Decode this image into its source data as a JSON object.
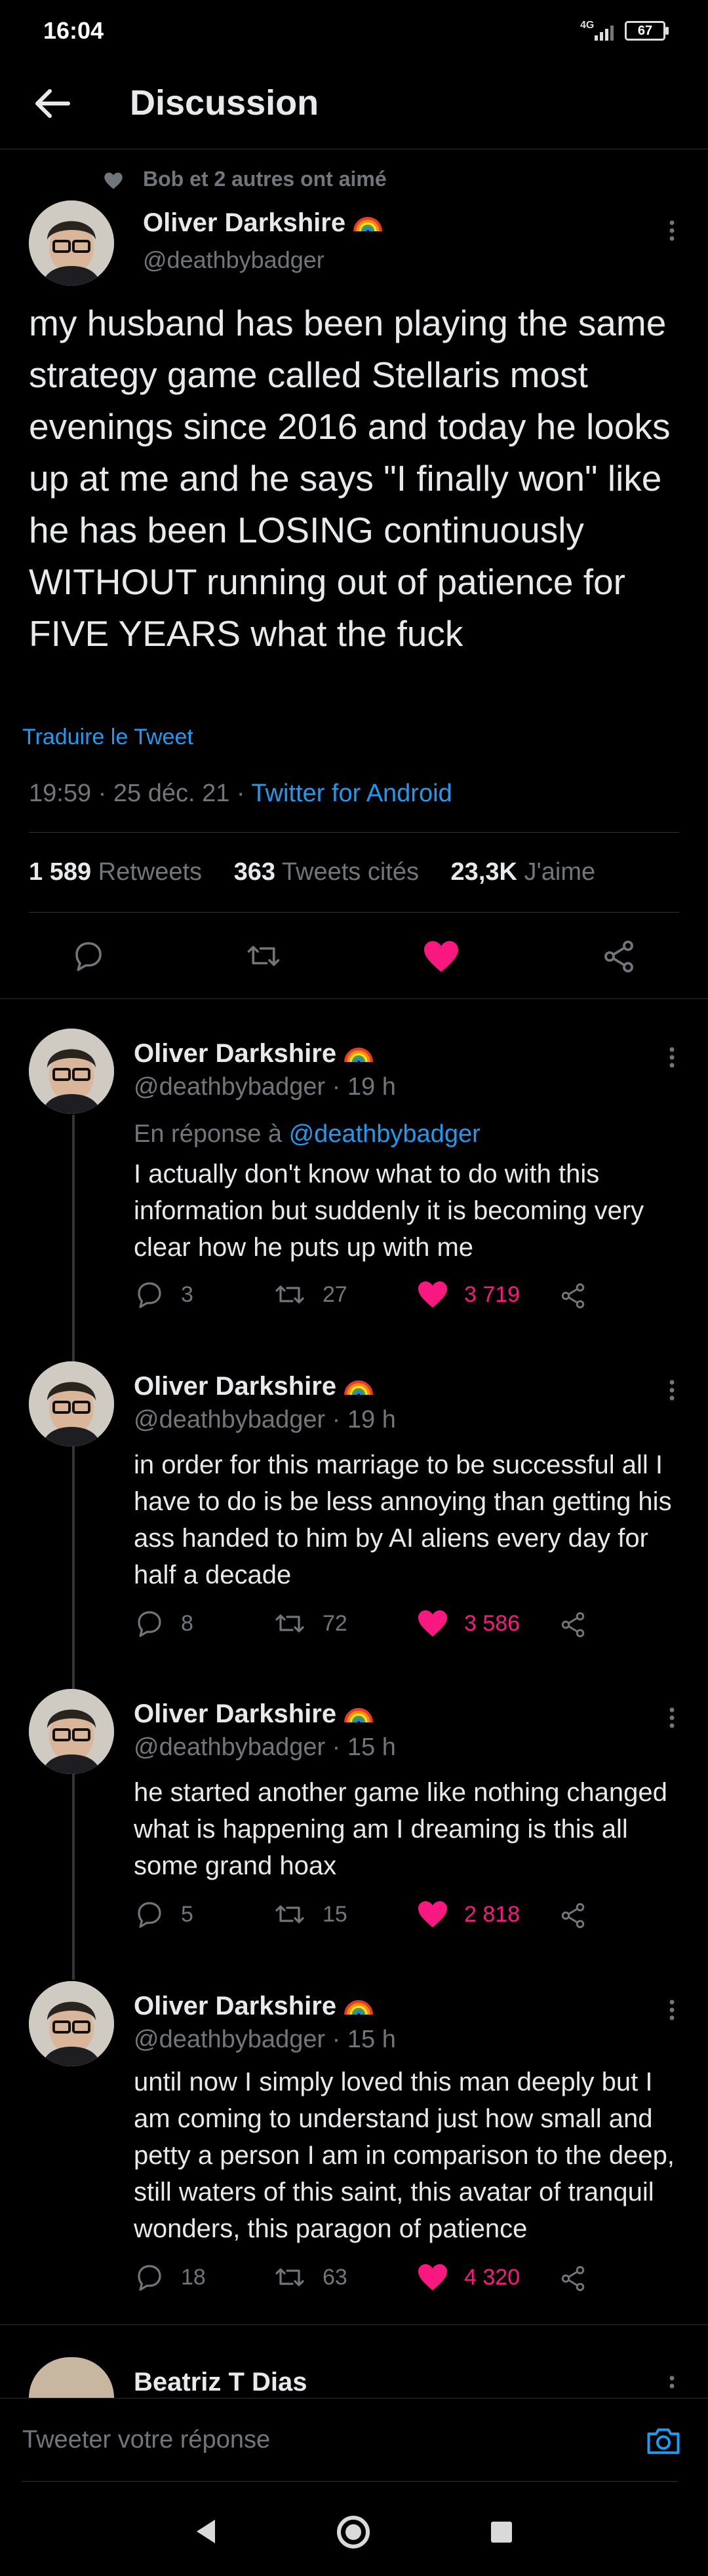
{
  "status_bar": {
    "time": "16:04",
    "network": "4G",
    "battery": "67"
  },
  "header": {
    "title": "Discussion"
  },
  "main_tweet": {
    "social_context": "Bob et 2 autres ont aimé",
    "author_name": "Oliver Darkshire",
    "author_handle": "@deathbybadger",
    "text": "my husband has been playing the same strategy game called Stellaris most evenings since 2016 and today he looks up at me and he says \"I finally won\" like he has been LOSING continuously WITHOUT running out of patience for FIVE YEARS what the fuck",
    "translate_label": "Traduire le Tweet",
    "timestamp": "19:59 · 25 déc. 21 · ",
    "source": "Twitter for Android",
    "stats": {
      "retweets_count": "1 589",
      "retweets_label": "Retweets",
      "quotes_count": "363",
      "quotes_label": "Tweets cités",
      "likes_count": "23,3K",
      "likes_label": "J'aime"
    }
  },
  "replies": [
    {
      "author_name": "Oliver Darkshire",
      "handle_time": "@deathbybadger · 19 h",
      "reply_to_prefix": "En réponse à ",
      "reply_to_handle": "@deathbybadger",
      "text": "I actually don't know what to do with this information but suddenly it is becoming very clear how he puts up with me",
      "replies": "3",
      "retweets": "27",
      "likes": "3 719"
    },
    {
      "author_name": "Oliver Darkshire",
      "handle_time": "@deathbybadger · 19 h",
      "text": "in order for this marriage to be successful all I have to do is be less annoying than getting his ass handed to him by AI aliens every day for half a decade",
      "replies": "8",
      "retweets": "72",
      "likes": "3 586"
    },
    {
      "author_name": "Oliver Darkshire",
      "handle_time": "@deathbybadger · 15 h",
      "text": "he started another game like nothing changed what is happening am I dreaming is this all some grand hoax",
      "replies": "5",
      "retweets": "15",
      "likes": "2 818"
    },
    {
      "author_name": "Oliver Darkshire",
      "handle_time": "@deathbybadger · 15 h",
      "text": "until now I simply loved this man deeply but I am coming to understand just how small and petty a person I am in comparison to the deep, still waters of this saint, this avatar of tranquil wonders, this paragon of patience",
      "replies": "18",
      "retweets": "63",
      "likes": "4 320"
    }
  ],
  "next_reply": {
    "author_name": "Beatriz T Dias"
  },
  "composer": {
    "placeholder": "Tweeter votre réponse"
  },
  "colors": {
    "background": "#000000",
    "accent": "#1d9bf0",
    "like": "#f91880",
    "muted": "#71767b"
  }
}
